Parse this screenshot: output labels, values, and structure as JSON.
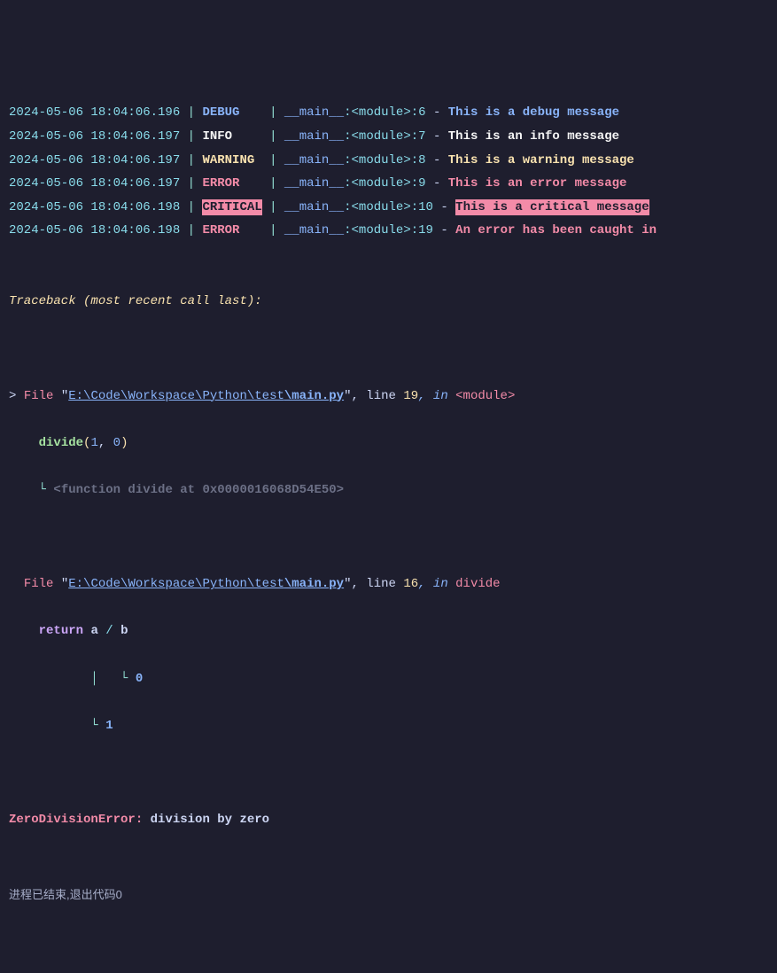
{
  "logs": [
    {
      "ts": "2024-05-06 18:04:06.196",
      "level": "DEBUG",
      "level_pad": "DEBUG   ",
      "level_cls": "lvl-debug",
      "msg_cls": "msg-debug",
      "module": "__main__",
      "tag": "<module>",
      "line": "6",
      "msg": "This is a debug message"
    },
    {
      "ts": "2024-05-06 18:04:06.197",
      "level": "INFO",
      "level_pad": "INFO    ",
      "level_cls": "lvl-info",
      "msg_cls": "msg-info",
      "module": "__main__",
      "tag": "<module>",
      "line": "7",
      "msg": "This is an info message"
    },
    {
      "ts": "2024-05-06 18:04:06.197",
      "level": "WARNING",
      "level_pad": "WARNING ",
      "level_cls": "lvl-warn",
      "msg_cls": "msg-warn",
      "module": "__main__",
      "tag": "<module>",
      "line": "8",
      "msg": "This is a warning message"
    },
    {
      "ts": "2024-05-06 18:04:06.197",
      "level": "ERROR",
      "level_pad": "ERROR   ",
      "level_cls": "lvl-err",
      "msg_cls": "msg-err",
      "module": "__main__",
      "tag": "<module>",
      "line": "9",
      "msg": "This is an error message"
    },
    {
      "ts": "2024-05-06 18:04:06.198",
      "level": "CRITICAL",
      "level_pad": "CRITICAL",
      "level_cls": "lvl-crit",
      "msg_cls": "msg-crit",
      "module": "__main__",
      "tag": "<module>",
      "line": "10",
      "msg": "This is a critical message"
    },
    {
      "ts": "2024-05-06 18:04:06.198",
      "level": "ERROR",
      "level_pad": "ERROR   ",
      "level_cls": "lvl-err",
      "msg_cls": "msg-err",
      "module": "__main__",
      "tag": "<module>",
      "line": "19",
      "msg": "An error has been caught in"
    }
  ],
  "traceback": {
    "header": "Traceback (most recent call last):",
    "frame1": {
      "prefix": "> ",
      "file_kw": "File ",
      "quote": "\"",
      "path_dir": "E:\\Code\\Workspace\\Python\\test",
      "path_file": "\\main.py",
      "line_kw": ", line ",
      "line": "19",
      "in_kw": ", in ",
      "scope": "<module>",
      "call_fn": "divide",
      "call_open": "(",
      "arg1": "1",
      "comma": ", ",
      "arg2": "0",
      "call_close": ")",
      "box": "    └ ",
      "repr": "<function divide at 0x0000016068D54E50>"
    },
    "frame2": {
      "prefix": "  ",
      "file_kw": "File ",
      "quote": "\"",
      "path_dir": "E:\\Code\\Workspace\\Python\\test",
      "path_file": "\\main.py",
      "line_kw": ", line ",
      "line": "16",
      "in_kw": ", in ",
      "scope": "divide",
      "ret_kw": "return",
      "var_a": "a",
      "op": " / ",
      "var_b": "b",
      "box_b": "           │   └ ",
      "val_b": "0",
      "box_a": "           └ ",
      "val_a": "1"
    },
    "exc_name": "ZeroDivisionError",
    "exc_colon": ": ",
    "exc_msg": "division by zero"
  },
  "footer": "进程已结束,退出代码0"
}
